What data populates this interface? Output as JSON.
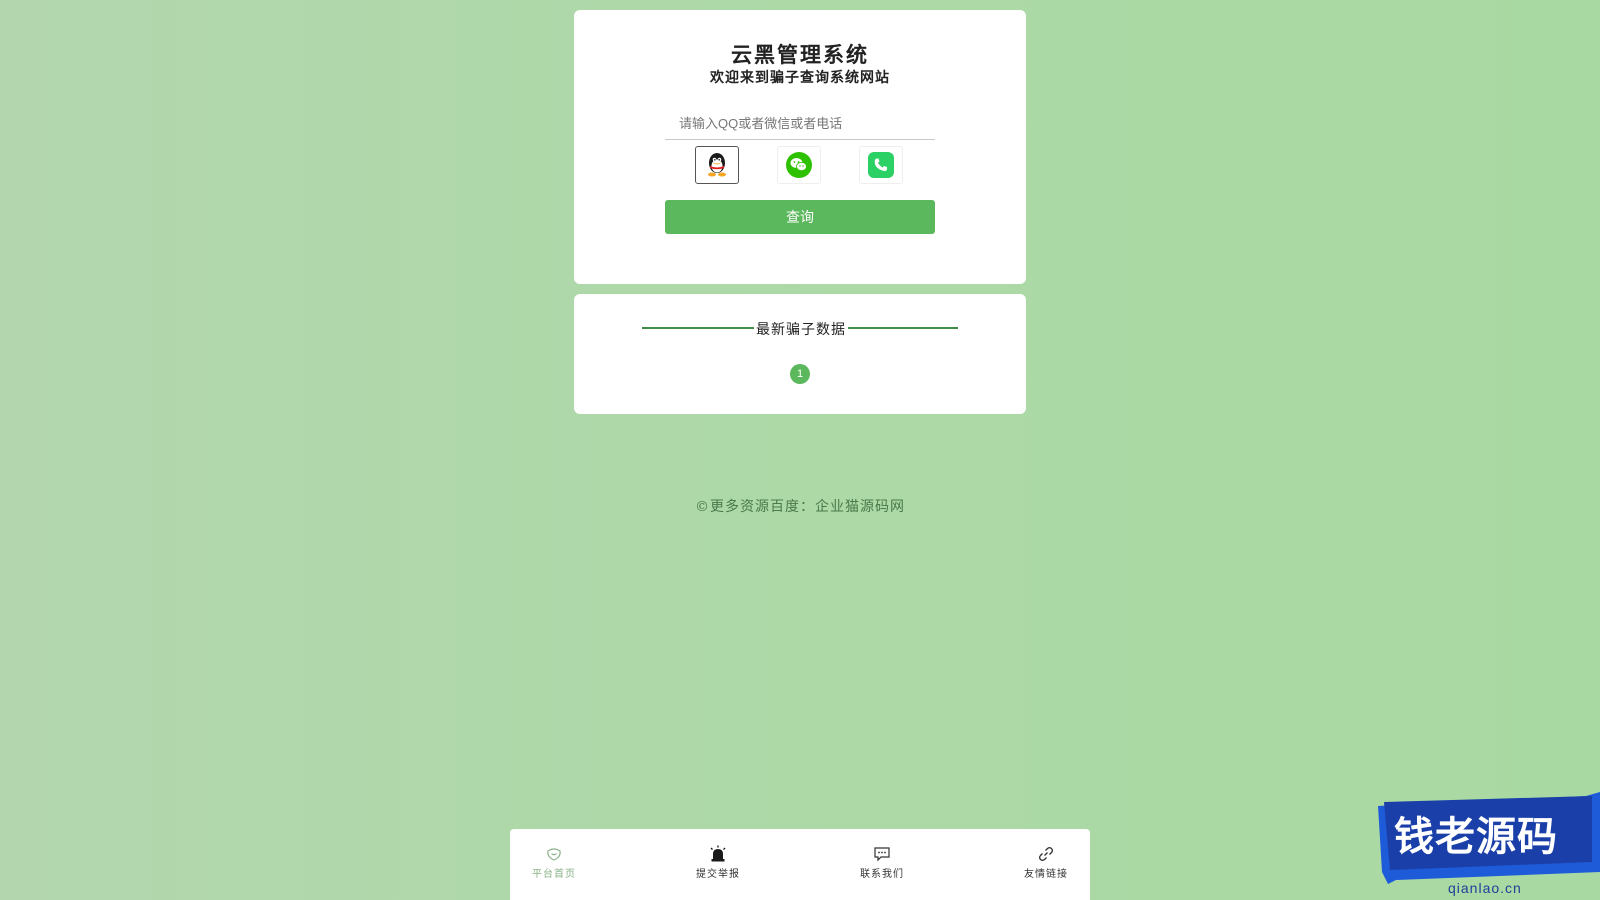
{
  "header": {
    "title": "云黑管理系统",
    "subtitle": "欢迎来到骗子查询系统网站"
  },
  "search": {
    "placeholder": "请输入QQ或者微信或者电话",
    "value": "",
    "types": [
      {
        "icon": "qq-penguin-icon",
        "active": true
      },
      {
        "icon": "wechat-icon",
        "active": false
      },
      {
        "icon": "phone-icon",
        "active": false
      }
    ],
    "submit_label": "查询"
  },
  "latest": {
    "title": "最新骗子数据",
    "page": "1"
  },
  "footer": {
    "text": "©更多资源百度：企业猫源码网"
  },
  "bottom_nav": {
    "items": [
      {
        "label": "平台首页",
        "icon": "home-icon"
      },
      {
        "label": "提交举报",
        "icon": "alarm-icon"
      },
      {
        "label": "联系我们",
        "icon": "chat-icon"
      },
      {
        "label": "友情链接",
        "icon": "link-icon"
      }
    ]
  },
  "watermark": {
    "text": "钱老源码",
    "url": "qianlao.cn"
  },
  "colors": {
    "background": "#acd9a6",
    "accent": "#5cb85c",
    "divider": "#3f8f4a",
    "watermark": "#1e5bd8"
  }
}
